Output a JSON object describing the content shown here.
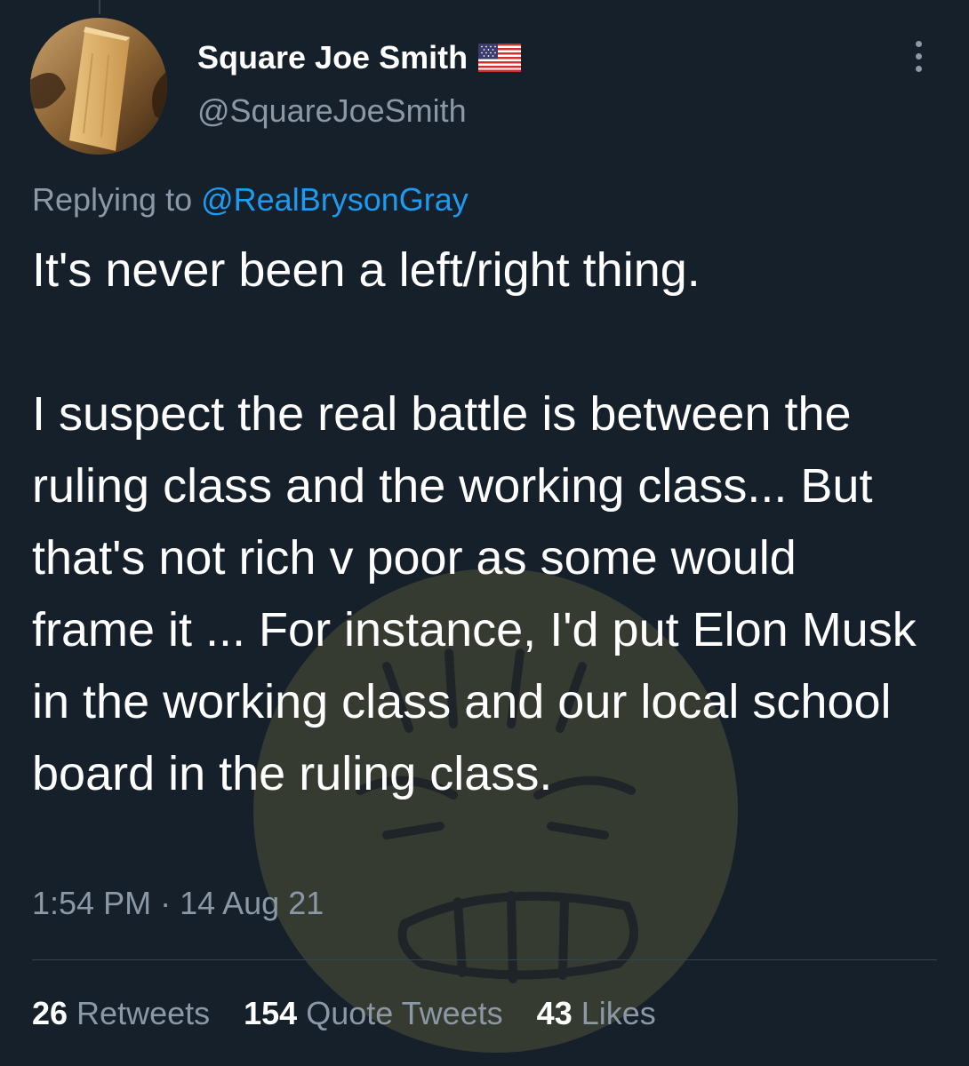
{
  "tweet": {
    "author": {
      "display_name": "Square Joe Smith",
      "handle": "@SquareJoeSmith",
      "flag_icon": "us-flag-icon",
      "avatar_icon": "wooden-block-avatar"
    },
    "more_icon": "more-options-icon",
    "reply_context": {
      "prefix": "Replying to ",
      "mention": "@RealBrysonGray"
    },
    "text": {
      "paragraph_1": "It's never been a left/right thing.",
      "paragraph_2": "I suspect the real battle is between the ruling class and the working class... But that's not rich v poor as some would frame it ... For instance, I'd put Elon Musk in the working class and our local school board in the ruling class."
    },
    "timestamp": {
      "time": "1:54 PM",
      "separator": " · ",
      "date": "14 Aug 21"
    },
    "stats": [
      {
        "count": "26",
        "label": " Retweets"
      },
      {
        "count": "154",
        "label": " Quote Tweets"
      },
      {
        "count": "43",
        "label": " Likes"
      }
    ]
  },
  "colors": {
    "background": "#15202b",
    "primary_text": "#ffffff",
    "secondary_text": "#8b98a5",
    "link": "#1d9bf0",
    "divider": "#38444d"
  }
}
